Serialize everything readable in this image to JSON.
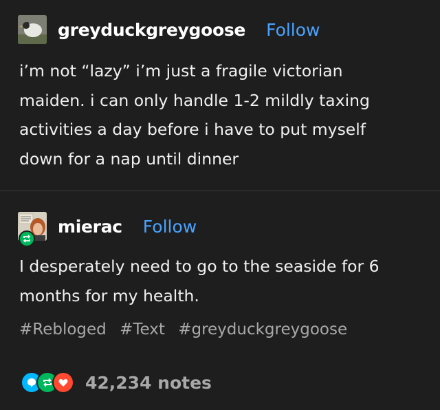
{
  "post1": {
    "username": "greyduckgreygoose",
    "follow_label": "Follow",
    "lines": [
      "i’m not “lazy” i’m just a fragile victorian",
      "maiden. i can only handle 1-2 mildly taxing",
      "activities a day before i have to put myself",
      "down for a nap until dinner"
    ]
  },
  "post2": {
    "username": "mierac",
    "follow_label": "Follow",
    "lines": [
      "I desperately need to go to the seaside for 6",
      "months for my health."
    ],
    "tags": [
      "#Rebloged",
      "#Text",
      "#greyduckgreygoose"
    ],
    "notes_count": "42,234 notes",
    "note_icons": [
      "comment-icon",
      "reblog-icon",
      "heart-icon"
    ]
  },
  "colors": {
    "background": "#1e1e1e",
    "follow_link": "#4aa3ff",
    "tag_text": "#a8a8a8",
    "comment_blue": "#00b8ff",
    "reblog_green": "#00b85c",
    "heart_red": "#ff4930"
  }
}
